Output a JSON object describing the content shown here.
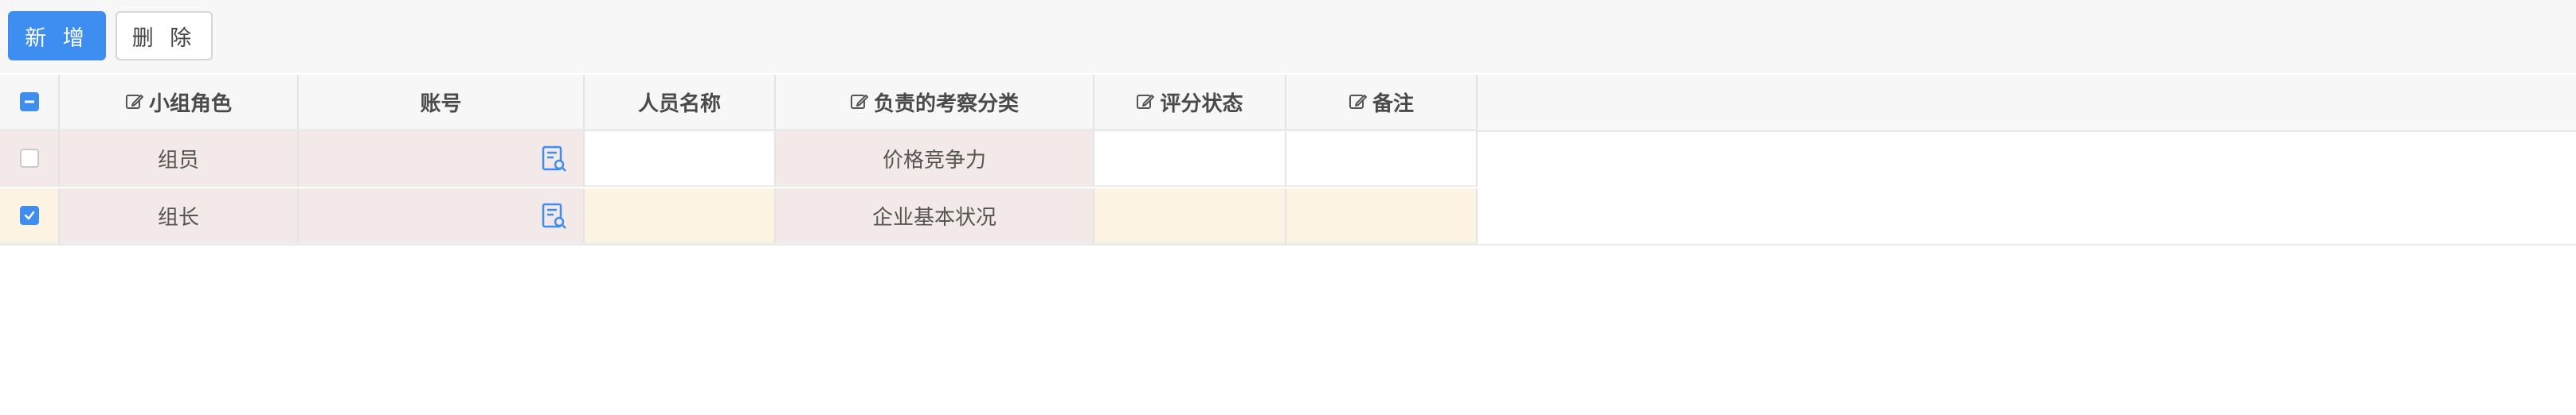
{
  "toolbar": {
    "add_label": "新 增",
    "delete_label": "删 除"
  },
  "table": {
    "columns": [
      {
        "label": "",
        "editable": false
      },
      {
        "label": "小组角色",
        "editable": true
      },
      {
        "label": "账号",
        "editable": false
      },
      {
        "label": "人员名称",
        "editable": false
      },
      {
        "label": "负责的考察分类",
        "editable": true
      },
      {
        "label": "评分状态",
        "editable": true
      },
      {
        "label": "备注",
        "editable": true
      }
    ],
    "rows": [
      {
        "checked": false,
        "role": "组员",
        "account": "",
        "name": "",
        "category": "价格竞争力",
        "status": "",
        "remark": ""
      },
      {
        "checked": true,
        "role": "组长",
        "account": "",
        "name": "",
        "category": "企业基本状况",
        "status": "",
        "remark": ""
      }
    ]
  },
  "colors": {
    "primary": "#3d8ef0",
    "readonly_bg": "#f3e9e8",
    "selected_row_bg": "#fdf3e3"
  },
  "icons": {
    "edit": "edit-icon",
    "lookup": "search-document-icon"
  }
}
